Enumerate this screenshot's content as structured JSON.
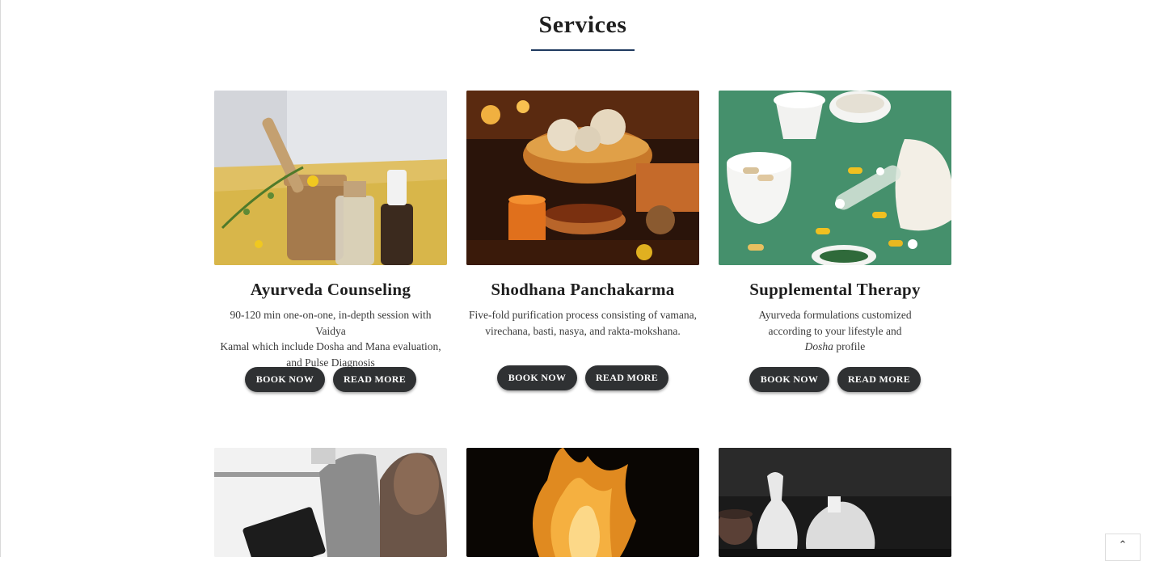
{
  "section": {
    "title": "Services"
  },
  "cards": [
    {
      "title": "Ayurveda Counseling",
      "desc_lines": [
        "90-120 min one-on-one, in-depth session with Vaidya",
        "Kamal which include Dosha and Mana evaluation,",
        "and Pulse Diagnosis"
      ],
      "book_label": "BOOK NOW",
      "read_label": "READ MORE"
    },
    {
      "title": "Shodhana Panchakarma",
      "desc_lines": [
        "Five-fold purification process consisting of vamana,",
        "virechana, basti, nasya, and rakta-mokshana."
      ],
      "book_label": "BOOK NOW",
      "read_label": "READ MORE"
    },
    {
      "title": "Supplemental Therapy",
      "desc_lines": [
        "Ayurveda formulations customized",
        "according to your lifestyle and"
      ],
      "desc_italic": "Dosha",
      "desc_tail": " profile",
      "book_label": "BOOK NOW",
      "read_label": "READ MORE"
    }
  ],
  "scroll_top": {
    "icon": "chevron-up-icon",
    "glyph": "⌃"
  },
  "colors": {
    "button": "#2f3133",
    "title_rule": "#1f3a5f"
  }
}
